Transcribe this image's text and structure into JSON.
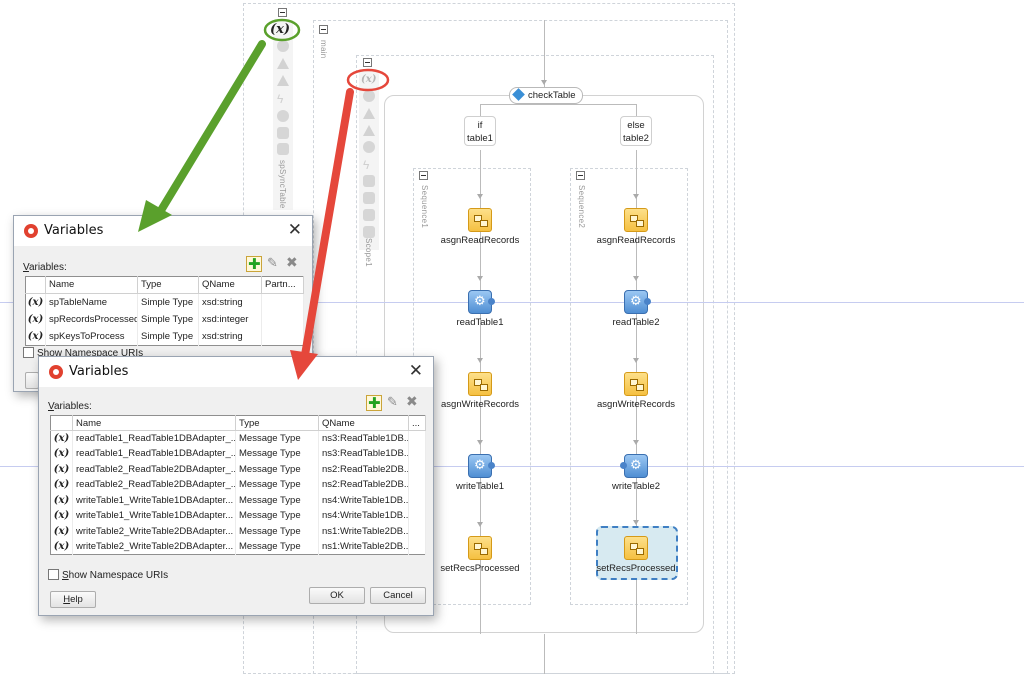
{
  "canvas": {
    "scopes": {
      "outer_label": "spSyncTable",
      "main_label": "main",
      "scope1_label": "Scope1",
      "sequence1_label": "Sequence1",
      "sequence2_label": "Sequence2"
    },
    "variables_icon": "(x)",
    "switch_label": "checkTable",
    "branches": {
      "if_line1": "if",
      "if_line2": "table1",
      "else_line1": "else",
      "else_line2": "table2"
    },
    "left_activities": {
      "a1": "asgnReadRecords",
      "a2": "readTable1",
      "a3": "asgnWriteRecords",
      "a4": "writeTable1",
      "a5": "setRecsProcessed"
    },
    "right_activities": {
      "a1": "asgnReadRecords",
      "a2": "readTable2",
      "a3": "asgnWriteRecords",
      "a4": "writeTable2",
      "a5": "setRecsProcessed"
    }
  },
  "dialog1": {
    "title": "Variables",
    "close": "✕",
    "variables_label_first": "V",
    "variables_label_rest": "ariables:",
    "columns": {
      "name": "Name",
      "type": "Type",
      "qname": "QName",
      "partner": "Partn..."
    },
    "rows": [
      {
        "icon": "(x)",
        "name": "spTableName",
        "type": "Simple Type",
        "qname": "xsd:string",
        "partner": ""
      },
      {
        "icon": "(x)",
        "name": "spRecordsProcessed",
        "type": "Simple Type",
        "qname": "xsd:integer",
        "partner": ""
      },
      {
        "icon": "(x)",
        "name": "spKeysToProcess",
        "type": "Simple Type",
        "qname": "xsd:string",
        "partner": ""
      }
    ],
    "show_ns": "Show Namespace URIs"
  },
  "dialog2": {
    "title": "Variables",
    "close": "✕",
    "variables_label_first": "V",
    "variables_label_rest": "ariables:",
    "columns": {
      "name": "Name",
      "type": "Type",
      "qname": "QName",
      "more": "..."
    },
    "rows": [
      {
        "icon": "(x)",
        "name": "readTable1_ReadTable1DBAdapter_...",
        "type": "Message Type",
        "qname": "ns3:ReadTable1DB..."
      },
      {
        "icon": "(x)",
        "name": "readTable1_ReadTable1DBAdapter_...",
        "type": "Message Type",
        "qname": "ns3:ReadTable1DB..."
      },
      {
        "icon": "(x)",
        "name": "readTable2_ReadTable2DBAdapter_...",
        "type": "Message Type",
        "qname": "ns2:ReadTable2DB..."
      },
      {
        "icon": "(x)",
        "name": "readTable2_ReadTable2DBAdapter_...",
        "type": "Message Type",
        "qname": "ns2:ReadTable2DB..."
      },
      {
        "icon": "(x)",
        "name": "writeTable1_WriteTable1DBAdapter...",
        "type": "Message Type",
        "qname": "ns4:WriteTable1DB..."
      },
      {
        "icon": "(x)",
        "name": "writeTable1_WriteTable1DBAdapter...",
        "type": "Message Type",
        "qname": "ns4:WriteTable1DB..."
      },
      {
        "icon": "(x)",
        "name": "writeTable2_WriteTable2DBAdapter...",
        "type": "Message Type",
        "qname": "ns1:WriteTable2DB..."
      },
      {
        "icon": "(x)",
        "name": "writeTable2_WriteTable2DBAdapter...",
        "type": "Message Type",
        "qname": "ns1:WriteTable2DB..."
      }
    ],
    "show_ns_first": "S",
    "show_ns_rest": "how Namespace URIs",
    "help_first": "H",
    "help_rest": "elp",
    "ok": "OK",
    "cancel": "Cancel"
  },
  "annotations": {
    "green_color": "#5aa02c",
    "red_color": "#e5473b"
  }
}
